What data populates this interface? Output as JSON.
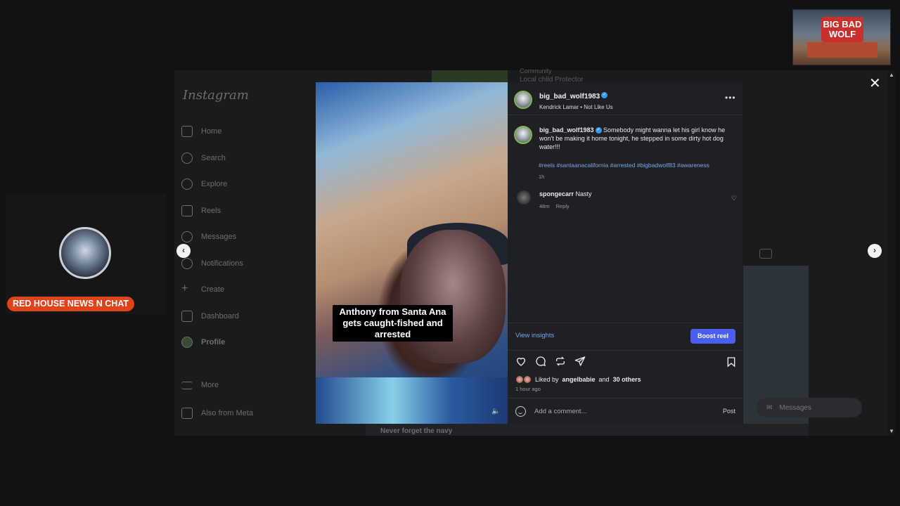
{
  "stream": {
    "thumb_logo": "BIG BAD WOLF",
    "channel_badge": "RED HOUSE NEWS N CHAT"
  },
  "instagram_bg": {
    "logo": "Instagram",
    "nav": [
      {
        "label": "Home",
        "icon": "home-icon"
      },
      {
        "label": "Search",
        "icon": "search-icon"
      },
      {
        "label": "Explore",
        "icon": "compass-icon"
      },
      {
        "label": "Reels",
        "icon": "reels-icon"
      },
      {
        "label": "Messages",
        "icon": "messenger-icon"
      },
      {
        "label": "Notifications",
        "icon": "heart-icon"
      },
      {
        "label": "Create",
        "icon": "plus-icon"
      },
      {
        "label": "Dashboard",
        "icon": "chart-icon"
      },
      {
        "label": "Profile",
        "icon": "avatar-icon"
      },
      {
        "label": "More",
        "icon": "menu-icon"
      },
      {
        "label": "Also from Meta",
        "icon": "meta-icon"
      }
    ],
    "bg_caption": "Never forget the navy",
    "bg_text_1": "Local child Protector",
    "bg_text_2": "Community",
    "messages_pill": "Messages"
  },
  "post": {
    "video_caption": "Anthony from Santa Ana gets caught-fished and arrested",
    "username": "big_bad_wolf1983",
    "audio": "Kendrick Lamar • Not Like Us",
    "caption": "Somebody might wanna let his girl know he won't be making it home tonight, he stepped in some dirty hot dog water!!!",
    "hashtags": "#reels #santaanacalifornia #arrested #bigbadwolf83 #awareness",
    "caption_time": "1h",
    "comments": [
      {
        "user": "spongecarr",
        "text": "Nasty",
        "time": "48m",
        "reply": "Reply"
      }
    ],
    "view_insights": "View insights",
    "boost": "Boost reel",
    "liked_prefix": "Liked by",
    "liked_user": "angelbabie",
    "liked_and": "and",
    "liked_others": "30 others",
    "post_time": "1 hour ago",
    "comment_placeholder": "Add a comment...",
    "post_button": "Post"
  }
}
